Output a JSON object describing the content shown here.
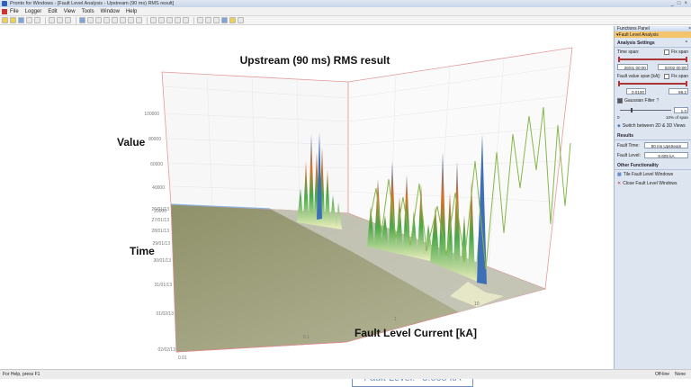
{
  "window": {
    "title": "Pronto for Windows - [Fault Level Analysis - Upstream (90 ms) RMS result]",
    "controls": [
      "_",
      "□",
      "×"
    ]
  },
  "menu": [
    "File",
    "Logger",
    "Edit",
    "View",
    "Tools",
    "Window",
    "Help"
  ],
  "chart": {
    "title": "Upstream (90 ms) RMS result",
    "value_label": "Value",
    "time_label": "Time",
    "x_label": "Fault Level Current [kA]",
    "value_ticks": [
      "100000",
      "80000",
      "60000",
      "40000",
      "20000"
    ],
    "time_ticks": [
      "26/01/13",
      "27/01/13",
      "28/01/13",
      "29/01/13",
      "30/01/13",
      "31/01/13",
      "01/02/13",
      "02/02/13"
    ],
    "x_ticks": [
      "0.01",
      "0.1",
      "1",
      "10"
    ],
    "fault_level_caption": "Fault Level:",
    "fault_level_value": "8.605 kA"
  },
  "panel": {
    "header": "Functions Panel",
    "tab": "Fault Level Analysis",
    "analysis_settings": {
      "title": "Analysis Settings",
      "time_span_label": "Time span:",
      "fix_span_label": "Fix span",
      "time_from": "26/01 00:00",
      "time_to": "02/02 00:00",
      "fault_span_label": "Fault value span [kA]:",
      "fault_from": "0.0100",
      "fault_to": "98.2",
      "gaussian_label": "Gaussian Filter",
      "gaussian_value": "1.0",
      "gaussian_min": "0",
      "gaussian_of_span": "10% of span",
      "switch_label": "Switch between 2D & 3D Views"
    },
    "results": {
      "title": "Results",
      "fault_time_label": "Fault Time:",
      "fault_time_value": "90 ms Upstream",
      "fault_level_label": "Fault Level:",
      "fault_level_value": "8.605 kA"
    },
    "other": {
      "title": "Other Functionality",
      "tile_label": "Tile Fault Level Windows",
      "close_label": "Close Fault Level Windows"
    }
  },
  "status": {
    "help": "For Help, press F1",
    "mode": "Off-line",
    "extra": "None"
  }
}
